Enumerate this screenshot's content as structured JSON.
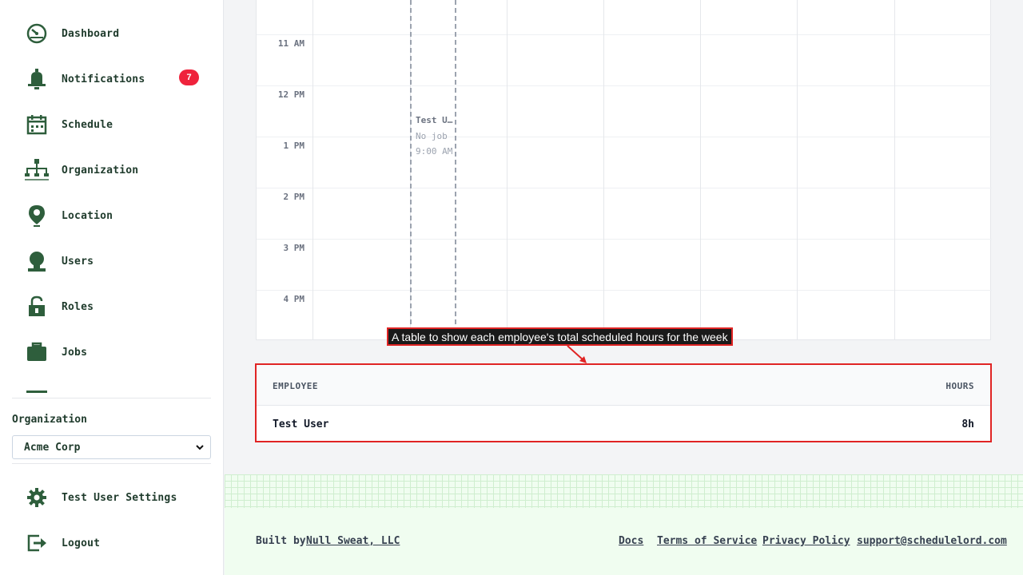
{
  "sidebar": {
    "items": [
      {
        "label": "Dashboard",
        "icon": "dashboard-icon"
      },
      {
        "label": "Notifications",
        "icon": "bell-icon",
        "badge": "7"
      },
      {
        "label": "Schedule",
        "icon": "calendar-icon"
      },
      {
        "label": "Organization",
        "icon": "org-chart-icon"
      },
      {
        "label": "Location",
        "icon": "location-pin-icon"
      },
      {
        "label": "Users",
        "icon": "user-icon"
      },
      {
        "label": "Roles",
        "icon": "lock-icon"
      },
      {
        "label": "Jobs",
        "icon": "briefcase-icon"
      }
    ],
    "org_label": "Organization",
    "org_selected": "Acme Corp",
    "settings_label": "Test User Settings",
    "logout_label": "Logout"
  },
  "calendar": {
    "time_labels": [
      "11 AM",
      "12 PM",
      "1 PM",
      "2 PM",
      "3 PM",
      "4 PM"
    ],
    "event": {
      "title": "Test User",
      "job": "No job",
      "time": "9:00 AM"
    }
  },
  "annotation": "A table to show each employee's total scheduled hours for the week",
  "hours_table": {
    "headers": {
      "employee": "EMPLOYEE",
      "hours": "HOURS"
    },
    "rows": [
      {
        "employee": "Test User",
        "hours": "8h"
      }
    ]
  },
  "footer": {
    "built_by_prefix": "Built by",
    "built_by_link": "Null Sweat, LLC",
    "links": [
      "Docs",
      "Terms of Service",
      "Privacy Policy",
      "support@schedulelord.com"
    ]
  },
  "colors": {
    "accent_green": "#2e5e3c",
    "badge_red": "#ef233c",
    "annotation_red": "#e02424",
    "footer_bg": "#f0fdf0"
  }
}
